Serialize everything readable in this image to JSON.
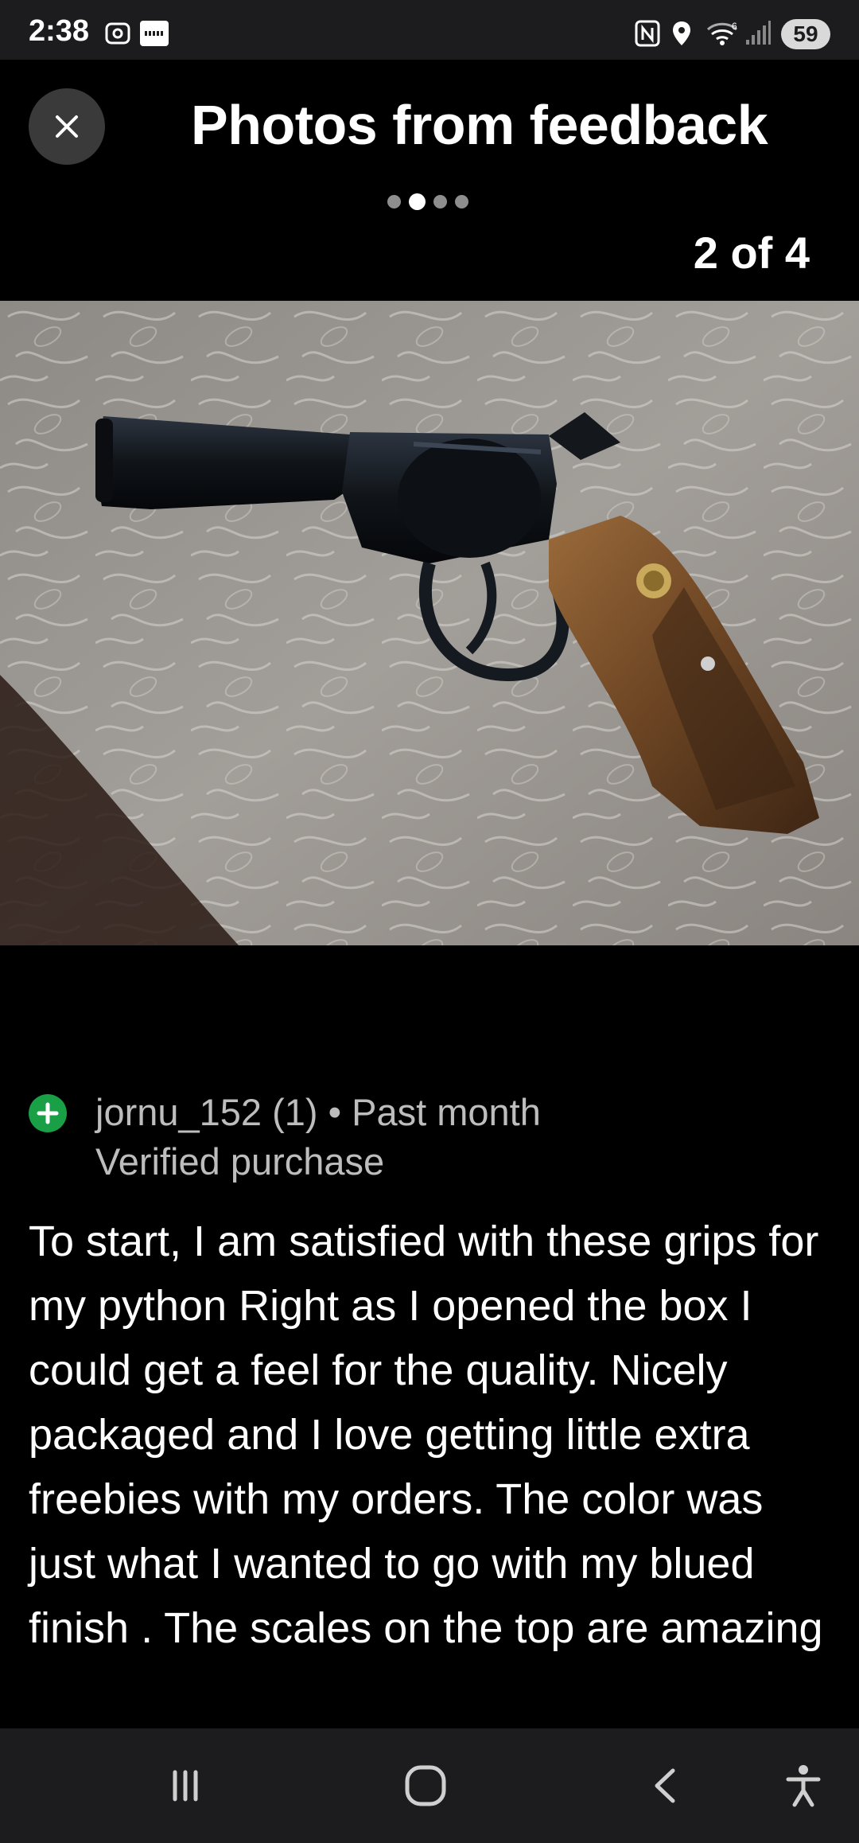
{
  "status_bar": {
    "time": "2:38",
    "battery": "59",
    "icons": [
      "screenshot-icon",
      "ifttt-icon",
      "nfc-icon",
      "location-icon",
      "wifi-6-icon",
      "signal-icon",
      "battery-icon"
    ]
  },
  "header": {
    "close_icon": "close-icon",
    "title": "Photos from feedback",
    "page_indicator": {
      "total": 4,
      "active_index": 1
    },
    "counter": "2 of 4"
  },
  "photo": {
    "subject": "revolver-with-wood-grips"
  },
  "review": {
    "badge_icon": "plus-icon",
    "username": "jornu_152 (1)",
    "separator": "•",
    "time_ago": "Past month",
    "user_line": "jornu_152 (1) • Past month",
    "verified": "Verified purchase",
    "text": "To start, I am satisfied with these grips for my python Right as I opened the box I could get a feel for the quality. Nicely packaged and I love getting little extra freebies with my orders. The color was just what I wanted to go with my blued finish . The scales on the top are amazing"
  },
  "nav_bar": {
    "icons": [
      "recent-apps-icon",
      "home-icon",
      "back-icon",
      "accessibility-icon"
    ]
  },
  "colors": {
    "background": "#000000",
    "bars": "#1c1c1e",
    "accent_green": "#19a047",
    "meta_text": "#bdbdbd"
  }
}
